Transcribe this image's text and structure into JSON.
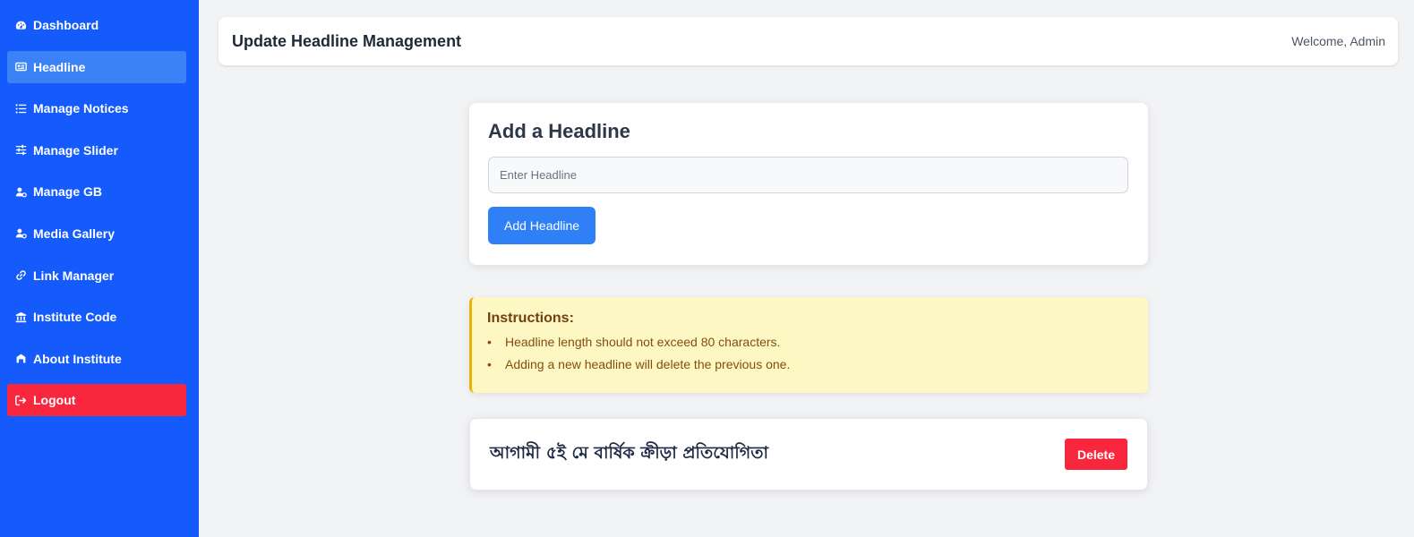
{
  "sidebar": {
    "items": [
      {
        "label": "Dashboard",
        "icon": "gauge-icon"
      },
      {
        "label": "Headline",
        "icon": "newspaper-icon"
      },
      {
        "label": "Manage Notices",
        "icon": "list-icon"
      },
      {
        "label": "Manage Slider",
        "icon": "sliders-icon"
      },
      {
        "label": "Manage GB",
        "icon": "user-gear-icon"
      },
      {
        "label": "Media Gallery",
        "icon": "user-gear-icon"
      },
      {
        "label": "Link Manager",
        "icon": "link-icon"
      },
      {
        "label": "Institute Code",
        "icon": "bank-icon"
      },
      {
        "label": "About Institute",
        "icon": "school-icon"
      }
    ],
    "logout": {
      "label": "Logout",
      "icon": "sign-out-icon"
    },
    "active_item": "Headline",
    "colors": {
      "bg": "#155bfb",
      "active": "#3b82f6",
      "logout": "#f9273e"
    }
  },
  "header": {
    "title": "Update Headline Management",
    "welcome": "Welcome, Admin"
  },
  "add_form": {
    "title": "Add a Headline",
    "input_placeholder": "Enter Headline",
    "input_value": "",
    "button_label": "Add Headline"
  },
  "instructions": {
    "title": "Instructions:",
    "items": [
      "Headline length should not exceed 80 characters.",
      "Adding a new headline will delete the previous one."
    ]
  },
  "current_headline": {
    "text": "আগামী ৫ই মে বার্ষিক ক্রীড়া প্রতিযোগিতা",
    "delete_label": "Delete"
  }
}
